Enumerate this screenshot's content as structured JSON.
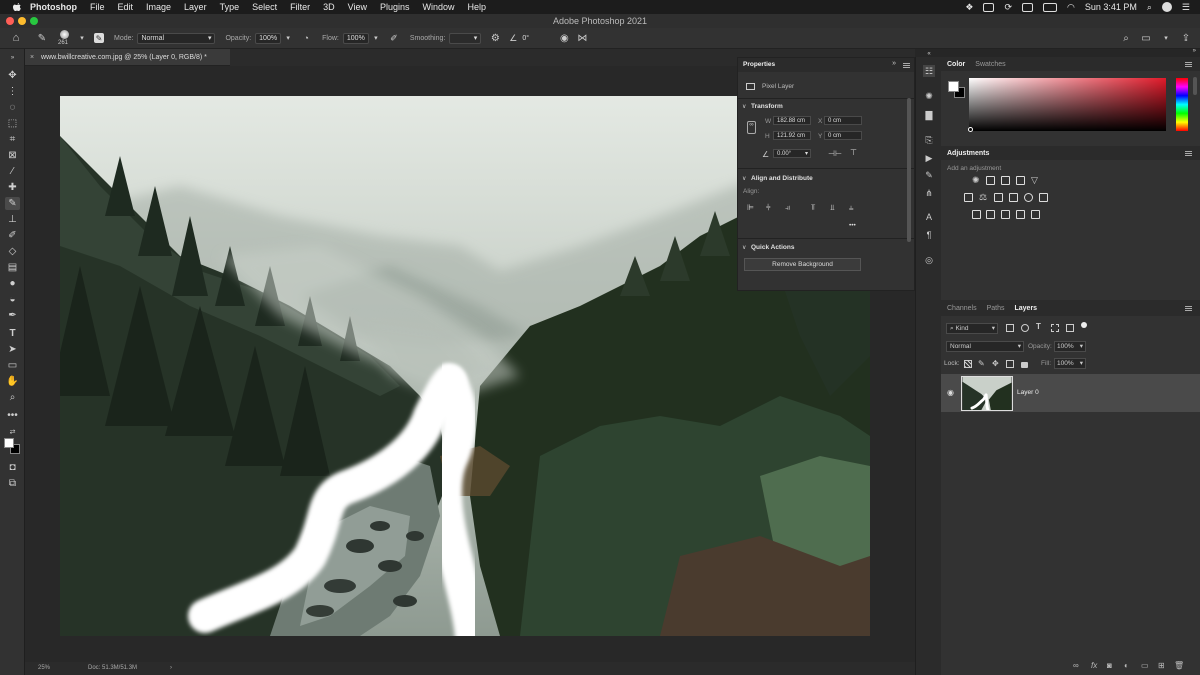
{
  "menubar": {
    "app": "Photoshop",
    "items": [
      "File",
      "Edit",
      "Image",
      "Layer",
      "Type",
      "Select",
      "Filter",
      "3D",
      "View",
      "Plugins",
      "Window",
      "Help"
    ],
    "clock": "Sun 3:41 PM"
  },
  "window": {
    "title": "Adobe Photoshop 2021"
  },
  "options": {
    "brush_size": "261",
    "mode_label": "Mode:",
    "mode_value": "Normal",
    "opacity_label": "Opacity:",
    "opacity_value": "100%",
    "flow_label": "Flow:",
    "flow_value": "100%",
    "smoothing_label": "Smoothing:",
    "angle_value": "0°"
  },
  "document": {
    "tab_title": "www.bwillcreative.com.jpg @ 25% (Layer 0, RGB/8) *",
    "zoom": "25%",
    "doc_size": "Doc: 51.3M/51.3M"
  },
  "properties": {
    "title": "Properties",
    "layer_type": "Pixel Layer",
    "transform_title": "Transform",
    "w_label": "W",
    "w_value": "182.88 cm",
    "h_label": "H",
    "h_value": "121.92 cm",
    "x_label": "X",
    "x_value": "0 cm",
    "y_label": "Y",
    "y_value": "0 cm",
    "angle_value": "0.00°",
    "align_title": "Align and Distribute",
    "align_label": "Align:",
    "more": "•••",
    "quick_title": "Quick Actions",
    "remove_bg": "Remove Background"
  },
  "color_panel": {
    "tabs": [
      "Color",
      "Swatches"
    ]
  },
  "adjustments": {
    "title": "Adjustments",
    "subtitle": "Add an adjustment"
  },
  "layers_panel": {
    "tabs": [
      "Channels",
      "Paths",
      "Layers"
    ],
    "filter": "Kind",
    "blend": "Normal",
    "opacity_label": "Opacity:",
    "opacity_value": "100%",
    "lock_label": "Lock:",
    "fill_label": "Fill:",
    "fill_value": "100%",
    "layer_name": "Layer 0"
  }
}
